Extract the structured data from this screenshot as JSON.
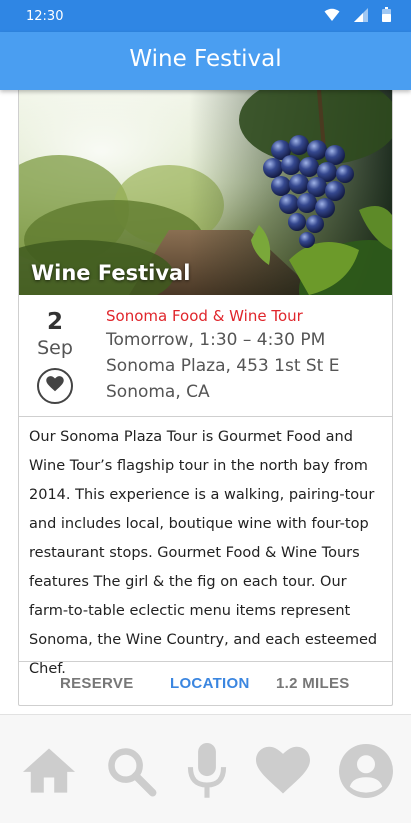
{
  "status_bar": {
    "time": "12:30"
  },
  "app_bar": {
    "title": "Wine Festival"
  },
  "card": {
    "hero_title": "Wine Festival",
    "date": {
      "day": "2",
      "month": "Sep"
    },
    "event": {
      "tour_name": "Sonoma Food & Wine Tour",
      "time": "Tomorrow, 1:30 – 4:30 PM",
      "address_line1": "Sonoma Plaza, 453 1st St E",
      "address_line2": "Sonoma, CA"
    },
    "description": "Our Sonoma Plaza Tour is Gourmet Food and Wine Tour’s flagship tour in the north bay from 2014. This experience is a walking, pairing-tour and includes local, boutique wine with four-top restaurant stops. Gourmet Food & Wine Tours features The girl & the fig on each tour. Our farm-to-table eclectic menu items represent Sonoma, the Wine Country, and each esteemed Chef.",
    "actions": {
      "reserve": "RESERVE",
      "location": "LOCATION",
      "distance": "1.2 MILES"
    }
  },
  "bottom_nav": {
    "items": [
      {
        "icon": "home-icon"
      },
      {
        "icon": "search-icon"
      },
      {
        "icon": "microphone-icon"
      },
      {
        "icon": "heart-icon"
      },
      {
        "icon": "account-icon"
      }
    ]
  },
  "colors": {
    "status_bar": "#2f86e4",
    "app_bar": "#4a9ef1",
    "accent": "#3b86e0",
    "tour_red": "#e0262c",
    "nav_icon": "#cdcdcd"
  }
}
